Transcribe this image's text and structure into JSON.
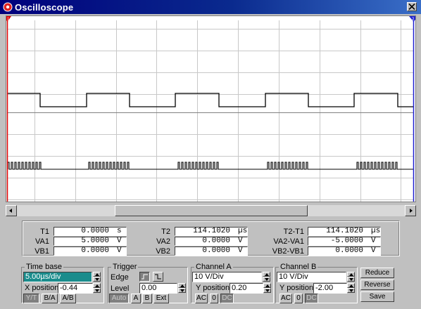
{
  "window": {
    "title": "Oscilloscope",
    "accent": "#00007c"
  },
  "cursors": {
    "t1_label": "1",
    "t2_label": "2"
  },
  "readouts": {
    "t1": {
      "label": "T1",
      "value": "0.0000",
      "unit": "s"
    },
    "va1": {
      "label": "VA1",
      "value": "5.0000",
      "unit": "V"
    },
    "vb1": {
      "label": "VB1",
      "value": "0.0000",
      "unit": "V"
    },
    "t2": {
      "label": "T2",
      "value": "114.1020",
      "unit": "µs"
    },
    "va2": {
      "label": "VA2",
      "value": "0.0000",
      "unit": "V"
    },
    "vb2": {
      "label": "VB2",
      "value": "0.0000",
      "unit": "V"
    },
    "dt": {
      "label": "T2-T1",
      "value": "114.1020",
      "unit": "µs"
    },
    "dva": {
      "label": "VA2-VA1",
      "value": "-5.0000",
      "unit": "V"
    },
    "dvb": {
      "label": "VB2-VB1",
      "value": "0.0000",
      "unit": "V"
    }
  },
  "timebase": {
    "title": "Time base",
    "scale": "5.00µs/div",
    "xpos_label": "X position",
    "xpos": "-0.44",
    "modes": [
      "Y/T",
      "B/A",
      "A/B"
    ]
  },
  "trigger": {
    "title": "Trigger",
    "edge_label": "Edge",
    "level_label": "Level",
    "level": "0.00",
    "sources": [
      "Auto",
      "A",
      "B",
      "Ext"
    ]
  },
  "channel_a": {
    "title": "Channel A",
    "scale": "10 V/Div",
    "ypos_label": "Y position",
    "ypos": "0.20",
    "coupling": [
      "AC",
      "0",
      "DC"
    ]
  },
  "channel_b": {
    "title": "Channel B",
    "scale": "10 V/Div",
    "ypos_label": "Y position",
    "ypos": "-2.00",
    "coupling": [
      "AC",
      "0",
      "DC"
    ]
  },
  "actions": {
    "reduce": "Reduce",
    "reverse": "Reverse",
    "save": "Save"
  }
}
